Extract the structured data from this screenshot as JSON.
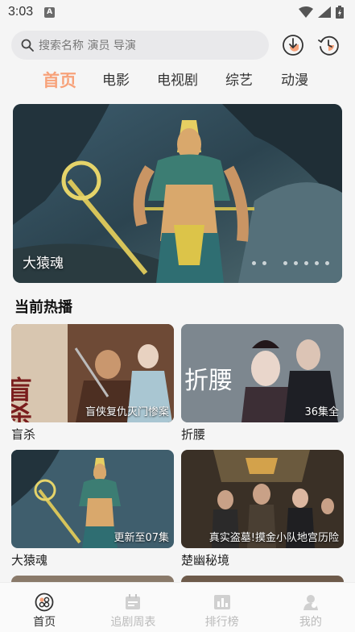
{
  "status": {
    "time": "3:03",
    "notif_letter": "A"
  },
  "search": {
    "placeholder": "搜索名称 演员 导演"
  },
  "tabs": [
    {
      "label": "首页",
      "active": true
    },
    {
      "label": "电影"
    },
    {
      "label": "电视剧"
    },
    {
      "label": "综艺"
    },
    {
      "label": "动漫"
    }
  ],
  "banner": {
    "caption": "大猿魂",
    "dot_count": 8
  },
  "section": {
    "title": "当前热播"
  },
  "cards": [
    {
      "title": "盲杀",
      "badge": "盲侠复仇灭门惨案",
      "poster_text": "盲杀"
    },
    {
      "title": "折腰",
      "badge": "36集全",
      "poster_text": "折腰"
    },
    {
      "title": "大猿魂",
      "badge": "更新至07集"
    },
    {
      "title": "楚幽秘境",
      "badge": "真实盗墓!摸金小队地宫历险"
    }
  ],
  "nav": [
    {
      "label": "首页",
      "icon": "home-icon",
      "active": true
    },
    {
      "label": "追剧周表",
      "icon": "calendar-icon"
    },
    {
      "label": "排行榜",
      "icon": "chart-icon"
    },
    {
      "label": "我的",
      "icon": "profile-icon"
    }
  ],
  "colors": {
    "accent": "#f7a27a",
    "search_bg": "#e9e9eb",
    "nav_inactive": "#bbbbbb"
  }
}
